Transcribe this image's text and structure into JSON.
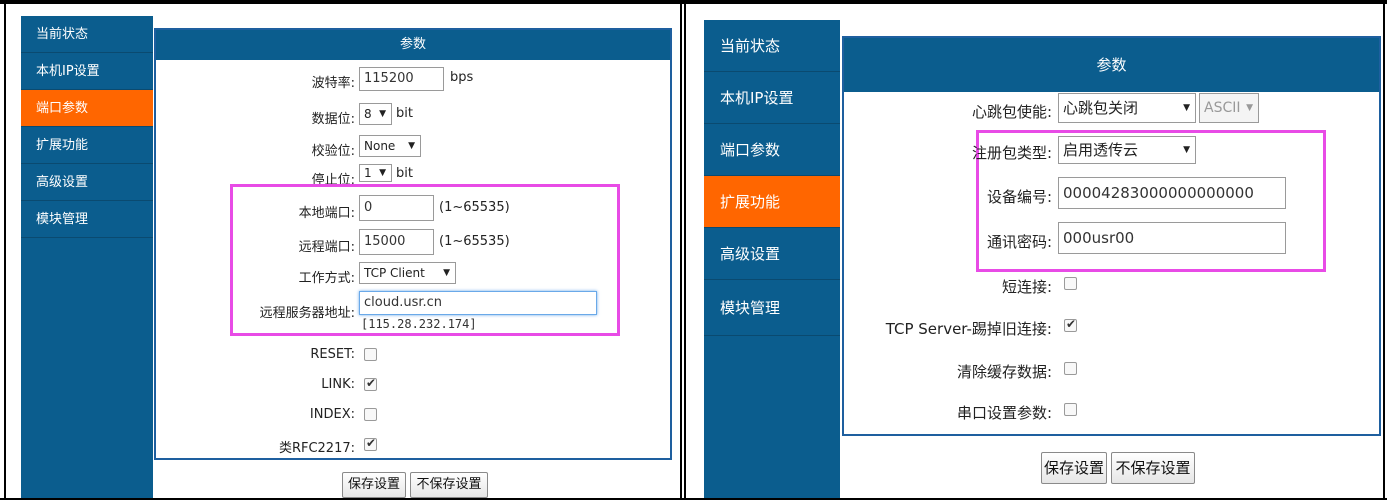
{
  "left_panel": {
    "sidebar": [
      {
        "label": "当前状态",
        "active": false
      },
      {
        "label": "本机IP设置",
        "active": false
      },
      {
        "label": "端口参数",
        "active": true
      },
      {
        "label": "扩展功能",
        "active": false
      },
      {
        "label": "高级设置",
        "active": false
      },
      {
        "label": "模块管理",
        "active": false
      }
    ],
    "header": "参数",
    "baud": {
      "label": "波特率:",
      "value": "115200",
      "unit": "bps"
    },
    "data_bits": {
      "label": "数据位:",
      "value": "8",
      "unit": "bit"
    },
    "parity": {
      "label": "校验位:",
      "value": "None"
    },
    "stop_bits": {
      "label": "停止位:",
      "value": "1",
      "unit": "bit"
    },
    "local_port": {
      "label": "本地端口:",
      "value": "0",
      "hint": "(1~65535)"
    },
    "remote_port": {
      "label": "远程端口:",
      "value": "15000",
      "hint": "(1~65535)"
    },
    "work_mode": {
      "label": "工作方式:",
      "value": "TCP Client"
    },
    "server_addr": {
      "label": "远程服务器地址:",
      "value": "cloud.usr.cn",
      "resolved": "[115.28.232.174]"
    },
    "reset": {
      "label": "RESET:",
      "checked": false
    },
    "link": {
      "label": "LINK:",
      "checked": true
    },
    "index": {
      "label": "INDEX:",
      "checked": false
    },
    "rfc2217": {
      "label": "类RFC2217:",
      "checked": true
    },
    "save_label": "保存设置",
    "nosave_label": "不保存设置"
  },
  "right_panel": {
    "sidebar": [
      {
        "label": "当前状态",
        "active": false
      },
      {
        "label": "本机IP设置",
        "active": false
      },
      {
        "label": "端口参数",
        "active": false
      },
      {
        "label": "扩展功能",
        "active": true
      },
      {
        "label": "高级设置",
        "active": false
      },
      {
        "label": "模块管理",
        "active": false
      }
    ],
    "header": "参数",
    "heartbeat": {
      "label": "心跳包使能:",
      "value": "心跳包关闭",
      "format": "ASCII"
    },
    "register_type": {
      "label": "注册包类型:",
      "value": "启用透传云"
    },
    "device_id": {
      "label": "设备编号:",
      "value": "00004283000000000000"
    },
    "password": {
      "label": "通讯密码:",
      "value": "000usr00"
    },
    "short_conn": {
      "label": "短连接:",
      "checked": false
    },
    "tcp_server_kick": {
      "label": "TCP Server-踢掉旧连接:",
      "checked": true
    },
    "clear_cache": {
      "label": "清除缓存数据:",
      "checked": false
    },
    "serial_params": {
      "label": "串口设置参数:",
      "checked": false
    },
    "save_label": "保存设置",
    "nosave_label": "不保存设置"
  },
  "colors": {
    "sidebar": "#0b5d8e",
    "active": "#ff6600",
    "highlight": "#e84be6"
  }
}
